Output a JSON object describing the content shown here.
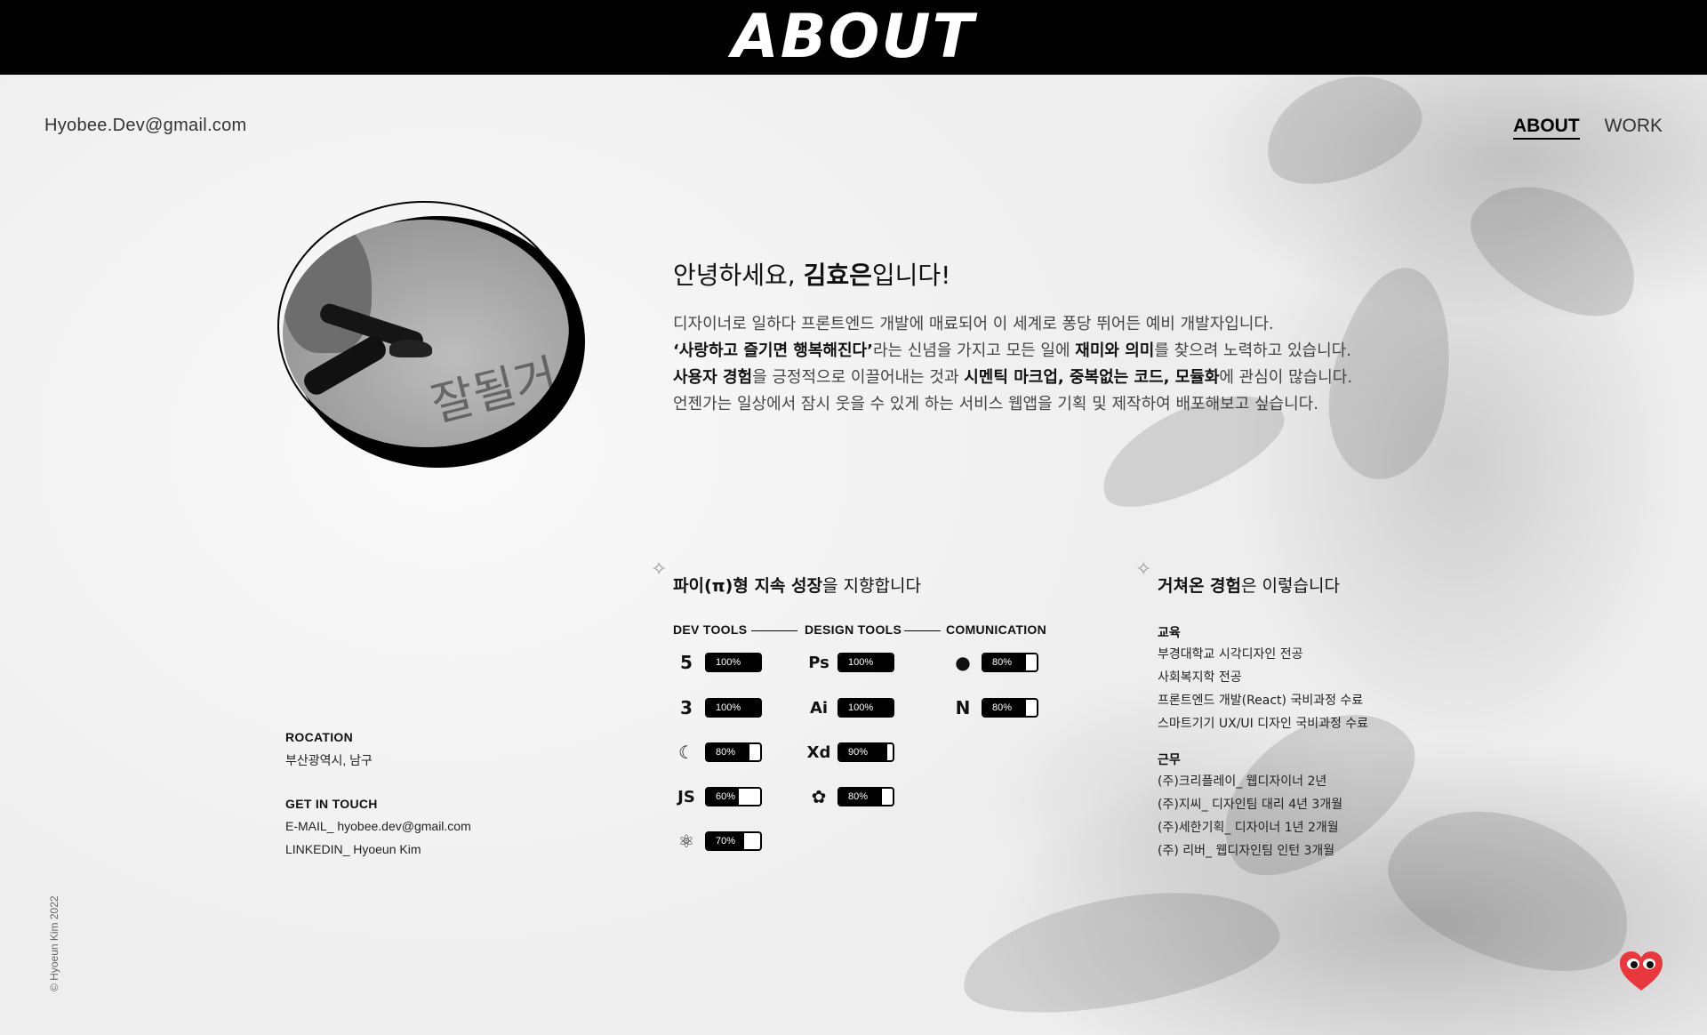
{
  "header": {
    "title": "ABOUT"
  },
  "top": {
    "email": "Hyobee.Dev@gmail.com",
    "nav": [
      {
        "label": "ABOUT",
        "active": true
      },
      {
        "label": "WORK",
        "active": false
      }
    ]
  },
  "intro": {
    "greeting_pre": "안녕하세요, ",
    "greeting_name": "김효은",
    "greeting_post": "입니다!",
    "line1": "디자이너로 일하다 프론트엔드 개발에 매료되어 이 세계로 퐁당 뛰어든 예비 개발자입니다.",
    "line2_a": "‘사랑하고 즐기면 행복해진다’",
    "line2_b": "라는 신념을 가지고  모든 일에 ",
    "line2_c": "재미와 의미",
    "line2_d": "를 찾으려 노력하고 있습니다.",
    "line3_a": "사용자 경험",
    "line3_b": "을 긍정적으로 이끌어내는 것과 ",
    "line3_c": "시멘틱 마크업, 중복없는 코드, 모듈화",
    "line3_d": "에 관심이 많습니다.",
    "line4": "언젠가는 일상에서 잠시 웃을 수 있게 하는 서비스 웹앱을 기획 및 제작하여 배포해보고 싶습니다."
  },
  "skills": {
    "heading_bold": "파이(π)형 지속 성장",
    "heading_rest": "을 지향합니다",
    "columns": [
      "DEV TOOLS",
      "DESIGN TOOLS",
      "COMUNICATION"
    ],
    "dev": [
      {
        "icon": "html5-icon",
        "glyph": "5",
        "percent": 100,
        "label": "100%"
      },
      {
        "icon": "css3-icon",
        "glyph": "3",
        "percent": 100,
        "label": "100%"
      },
      {
        "icon": "jquery-icon",
        "glyph": "☾",
        "percent": 80,
        "label": "80%"
      },
      {
        "icon": "javascript-icon",
        "glyph": "JS",
        "percent": 60,
        "label": "60%"
      },
      {
        "icon": "react-icon",
        "glyph": "⚛",
        "percent": 70,
        "label": "70%"
      }
    ],
    "design": [
      {
        "icon": "photoshop-icon",
        "glyph": "Ps",
        "percent": 100,
        "label": "100%"
      },
      {
        "icon": "illustrator-icon",
        "glyph": "Ai",
        "percent": 100,
        "label": "100%"
      },
      {
        "icon": "xd-icon",
        "glyph": "Xd",
        "percent": 90,
        "label": "90%"
      },
      {
        "icon": "figma-icon",
        "glyph": "✿",
        "percent": 80,
        "label": "80%"
      }
    ],
    "communication": [
      {
        "icon": "github-icon",
        "glyph": "●",
        "percent": 80,
        "label": "80%"
      },
      {
        "icon": "notion-icon",
        "glyph": "N",
        "percent": 80,
        "label": "80%"
      }
    ]
  },
  "experience": {
    "heading_bold": "거쳐온 경험",
    "heading_rest": "은 이렇습니다",
    "education_label": "교육",
    "education": [
      "부경대학교 시각디자인 전공",
      "사회복지학 전공",
      "프론트엔드 개발(React) 국비과정 수료",
      "스마트기기 UX/UI 디자인 국비과정 수료"
    ],
    "work_label": "근무",
    "work": [
      "(주)크리플레이_ 웹디자이너 2년",
      "(주)지씨_ 디자인팀 대리 4년 3개월",
      "(주)세한기획_ 디자이너 1년 2개월",
      "(주) 리버_ 웹디자인팀 인턴 3개월"
    ]
  },
  "contact": {
    "location_label": "ROCATION",
    "location": "부산광역시, 남구",
    "touch_label": "GET IN TOUCH",
    "email": "E-MAIL_ hyobee.dev@gmail.com",
    "linkedin": "LINKEDIN_ Hyoeun Kim"
  },
  "footer": {
    "copyright": "© Hyoeun Kim 2022"
  },
  "colors": {
    "accent": "#000000",
    "mascot": "#e8383d"
  }
}
